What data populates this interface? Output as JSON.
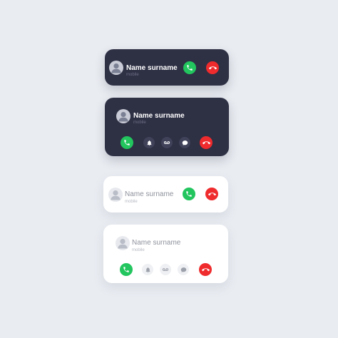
{
  "background_color": "#e9ecf1",
  "colors": {
    "dark_card": "#2e3044",
    "light_card": "#ffffff",
    "accept": "#22c55e",
    "decline": "#ef2b2d"
  },
  "cards": [
    {
      "theme": "dark",
      "layout": "compact",
      "caller_name": "Name surname",
      "caller_type": "mobile",
      "avatar_icon": "person-icon",
      "actions": [
        "accept-call",
        "decline-call"
      ]
    },
    {
      "theme": "dark",
      "layout": "expanded",
      "caller_name": "Name surname",
      "caller_type": "mobile",
      "avatar_icon": "person-icon",
      "actions": [
        "accept-call",
        "remind-me",
        "voicemail",
        "message",
        "decline-call"
      ]
    },
    {
      "theme": "light",
      "layout": "compact",
      "caller_name": "Name surname",
      "caller_type": "mobile",
      "avatar_icon": "person-icon",
      "actions": [
        "accept-call",
        "decline-call"
      ]
    },
    {
      "theme": "light",
      "layout": "expanded",
      "caller_name": "Name surname",
      "caller_type": "mobile",
      "avatar_icon": "person-icon",
      "actions": [
        "accept-call",
        "remind-me",
        "voicemail",
        "message",
        "decline-call"
      ]
    }
  ],
  "icons": {
    "accept": "phone-icon",
    "decline": "hang-up-icon",
    "remind": "bell-icon",
    "voicemail": "voicemail-icon",
    "message": "chat-bubble-icon"
  }
}
